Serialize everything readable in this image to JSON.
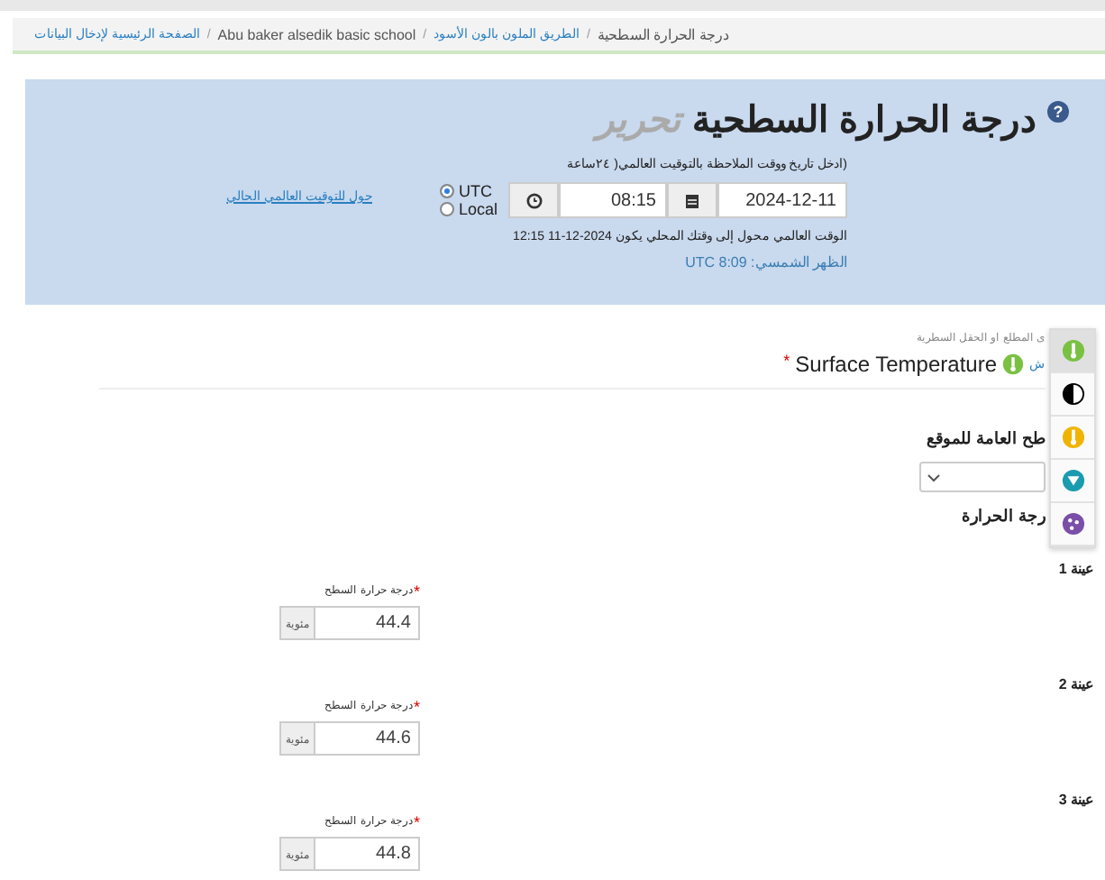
{
  "breadcrumb": [
    {
      "label": "درجة الحرارة السطحية",
      "link": false
    },
    {
      "label": "الطريق الملون بالون الأسود",
      "link": true,
      "separator": "/"
    },
    {
      "label": "Abu baker alsedik basic school",
      "link": false,
      "separator": "/"
    },
    {
      "label": "الصفحة الرئيسية لإدخال البيانات",
      "link": true,
      "separator": "/"
    }
  ],
  "header": {
    "help": "?",
    "title": "درجة الحرارة السطحية",
    "mode": "تحرير",
    "instruction": "(ادخل تاريخ ووقت الملاحظة بالتوقيت العالمي( ٢٤ساعة",
    "date": "2024-12-11",
    "time": "08:15",
    "timezones": [
      {
        "label": "UTC",
        "selected": true
      },
      {
        "label": "Local",
        "selected": false
      }
    ],
    "convert_link": "حول للتوقيت العالمي الحالي",
    "converted": "الوقت العالمي محول إلى وقتك المحلي يكون 2024-12-11 12:15",
    "solar_noon": "الظهر الشمسي: UTC 8:09"
  },
  "protocol": {
    "hint": "ى المطلع او الحقل السطرية",
    "link": "ش",
    "name": "Surface Temperature",
    "required": true,
    "required_mark": "*"
  },
  "site_heading": "طح العامة للموقع",
  "temp_heading": "رجة الحرارة",
  "samples": [
    {
      "title": "عينة 1",
      "field_label": "درجة حرارة السطح",
      "required": true,
      "required_mark": "*",
      "value": "44.4",
      "unit": "مئوية"
    },
    {
      "title": "عينة 2",
      "field_label": "درجة حرارة السطح",
      "required": true,
      "required_mark": "*",
      "value": "44.6",
      "unit": "مئوية"
    },
    {
      "title": "عينة 3",
      "field_label": "درجة حرارة السطح",
      "required": true,
      "required_mark": "*",
      "value": "44.8",
      "unit": "مئوية"
    }
  ],
  "toolbar": [
    {
      "kind": "thermometer",
      "color": "#7ac143",
      "selected": true
    },
    {
      "kind": "half",
      "color": "#000000",
      "selected": false
    },
    {
      "kind": "thermometer",
      "color": "#f0b400",
      "selected": false
    },
    {
      "kind": "funnel",
      "color": "#1a9bb0",
      "selected": false
    },
    {
      "kind": "dots",
      "color": "#7b4fa8",
      "selected": false
    }
  ]
}
